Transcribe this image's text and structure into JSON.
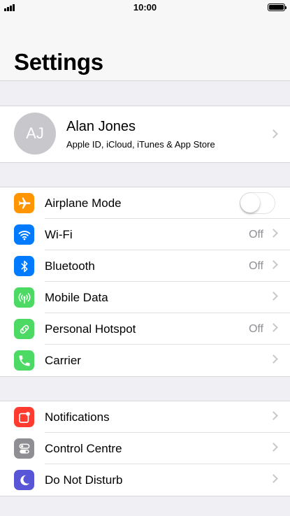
{
  "status_bar": {
    "time": "10:00"
  },
  "header": {
    "title": "Settings"
  },
  "profile": {
    "initials": "AJ",
    "name": "Alan Jones",
    "subtitle": "Apple ID, iCloud, iTunes & App Store"
  },
  "group1": {
    "airplane": {
      "label": "Airplane Mode",
      "toggle_on": false,
      "icon": "airplane-icon",
      "color": "#ff9500"
    },
    "wifi": {
      "label": "Wi-Fi",
      "value": "Off",
      "icon": "wifi-icon",
      "color": "#007aff"
    },
    "bluetooth": {
      "label": "Bluetooth",
      "value": "Off",
      "icon": "bluetooth-icon",
      "color": "#007aff"
    },
    "mobile_data": {
      "label": "Mobile Data",
      "icon": "antenna-icon",
      "color": "#4cd964"
    },
    "hotspot": {
      "label": "Personal Hotspot",
      "value": "Off",
      "icon": "hotspot-icon",
      "color": "#4cd964"
    },
    "carrier": {
      "label": "Carrier",
      "icon": "phone-icon",
      "color": "#4cd964"
    }
  },
  "group2": {
    "notifications": {
      "label": "Notifications",
      "icon": "notifications-icon",
      "color": "#ff3b30"
    },
    "control_centre": {
      "label": "Control Centre",
      "icon": "switches-icon",
      "color": "#8e8e93"
    },
    "dnd": {
      "label": "Do Not Disturb",
      "icon": "moon-icon",
      "color": "#5856d6"
    }
  }
}
